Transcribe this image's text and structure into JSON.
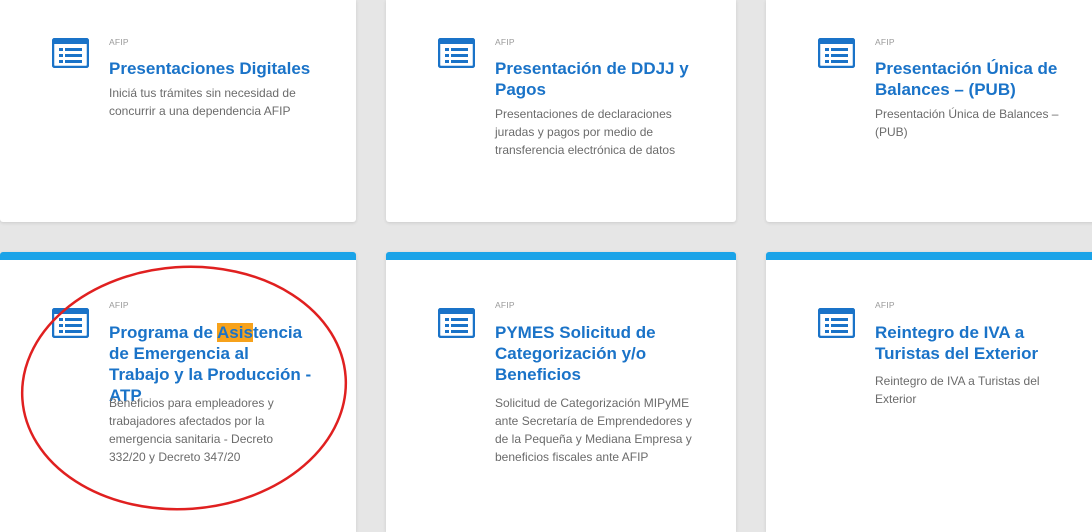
{
  "cards": [
    {
      "agency": "AFIP",
      "title": "Presentaciones Digitales",
      "description": "Iniciá tus trámites sin necesidad de concurrir a una dependencia AFIP"
    },
    {
      "agency": "AFIP",
      "title": "Presentación de DDJJ y Pagos",
      "description": "Presentaciones de declaraciones juradas y pagos por medio de transferencia electrónica de datos"
    },
    {
      "agency": "AFIP",
      "title": "Presentación Única de Balances – (PUB)",
      "description": "Presentación Única de Balances – (PUB)"
    },
    {
      "agency": "AFIP",
      "title_before": "Programa de ",
      "title_highlight": "Asis",
      "title_after": "tencia de Emergencia al Trabajo y la Producción - ATP",
      "description": "Beneficios para empleadores y trabajadores afectados por la emergencia sanitaria - Decreto 332/20 y Decreto 347/20"
    },
    {
      "agency": "AFIP",
      "title": "PYMES Solicitud de Categorización y/o Beneficios",
      "description": "Solicitud de Categorización MIPyME ante Secretaría de Emprendedores y de la Pequeña y Mediana Empresa y beneficios fiscales ante AFIP"
    },
    {
      "agency": "AFIP",
      "title": "Reintegro de IVA a Turistas del Exterior",
      "description": "Reintegro de IVA a Turistas del Exterior"
    }
  ],
  "colors": {
    "accent": "#1a73c8",
    "top_border": "#1aa3e8",
    "highlight": "#f7a21b",
    "annotation": "#e02020"
  },
  "icon_name": "list-icon"
}
